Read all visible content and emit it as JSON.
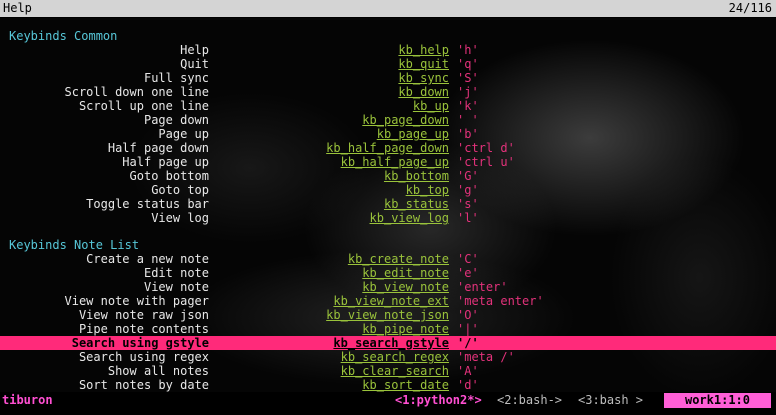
{
  "header": {
    "title": "Help",
    "position": "24/116"
  },
  "sections": [
    {
      "title": "Keybinds Common",
      "items": [
        {
          "label": "Help",
          "name": "kb_help",
          "key": "'h'"
        },
        {
          "label": "Quit",
          "name": "kb_quit",
          "key": "'q'"
        },
        {
          "label": "Full sync",
          "name": "kb_sync",
          "key": "'S'"
        },
        {
          "label": "Scroll down one line",
          "name": "kb_down",
          "key": "'j'"
        },
        {
          "label": "Scroll up one line",
          "name": "kb_up",
          "key": "'k'"
        },
        {
          "label": "Page down",
          "name": "kb_page_down",
          "key": "' '"
        },
        {
          "label": "Page up",
          "name": "kb_page_up",
          "key": "'b'"
        },
        {
          "label": "Half page down",
          "name": "kb_half_page_down",
          "key": "'ctrl d'"
        },
        {
          "label": "Half page up",
          "name": "kb_half_page_up",
          "key": "'ctrl u'"
        },
        {
          "label": "Goto bottom",
          "name": "kb_bottom",
          "key": "'G'"
        },
        {
          "label": "Goto top",
          "name": "kb_top",
          "key": "'g'"
        },
        {
          "label": "Toggle status bar",
          "name": "kb_status",
          "key": "'s'"
        },
        {
          "label": "View log",
          "name": "kb_view_log",
          "key": "'l'"
        }
      ]
    },
    {
      "title": "Keybinds Note List",
      "items": [
        {
          "label": "Create a new note",
          "name": "kb_create_note",
          "key": "'C'"
        },
        {
          "label": "Edit note",
          "name": "kb_edit_note",
          "key": "'e'"
        },
        {
          "label": "View note",
          "name": "kb_view_note",
          "key": "'enter'"
        },
        {
          "label": "View note with pager",
          "name": "kb_view_note_ext",
          "key": "'meta enter'"
        },
        {
          "label": "View note raw json",
          "name": "kb_view_note_json",
          "key": "'O'"
        },
        {
          "label": "Pipe note contents",
          "name": "kb_pipe_note",
          "key": "'|'"
        },
        {
          "label": "Search using gstyle",
          "name": "kb_search_gstyle",
          "key": "'/'"
        },
        {
          "label": "Search using regex",
          "name": "kb_search_regex",
          "key": "'meta /'"
        },
        {
          "label": "Show all notes",
          "name": "kb_clear_search",
          "key": "'A'"
        },
        {
          "label": "Sort notes by date",
          "name": "kb_sort_date",
          "key": "'d'"
        }
      ]
    }
  ],
  "selected_item": "kb_search_gstyle",
  "statusbar": {
    "session": "tiburon",
    "windows": [
      "<1:python2*>",
      "<2:bash->",
      "<3:bash >"
    ],
    "host": "work1:1:0"
  },
  "colors": {
    "section": "#57c7d8",
    "keyname": "#9ac33b",
    "keyvalue": "#e3327b",
    "highlight": "#ff2a7a",
    "status_accent": "#ff4fd2"
  }
}
